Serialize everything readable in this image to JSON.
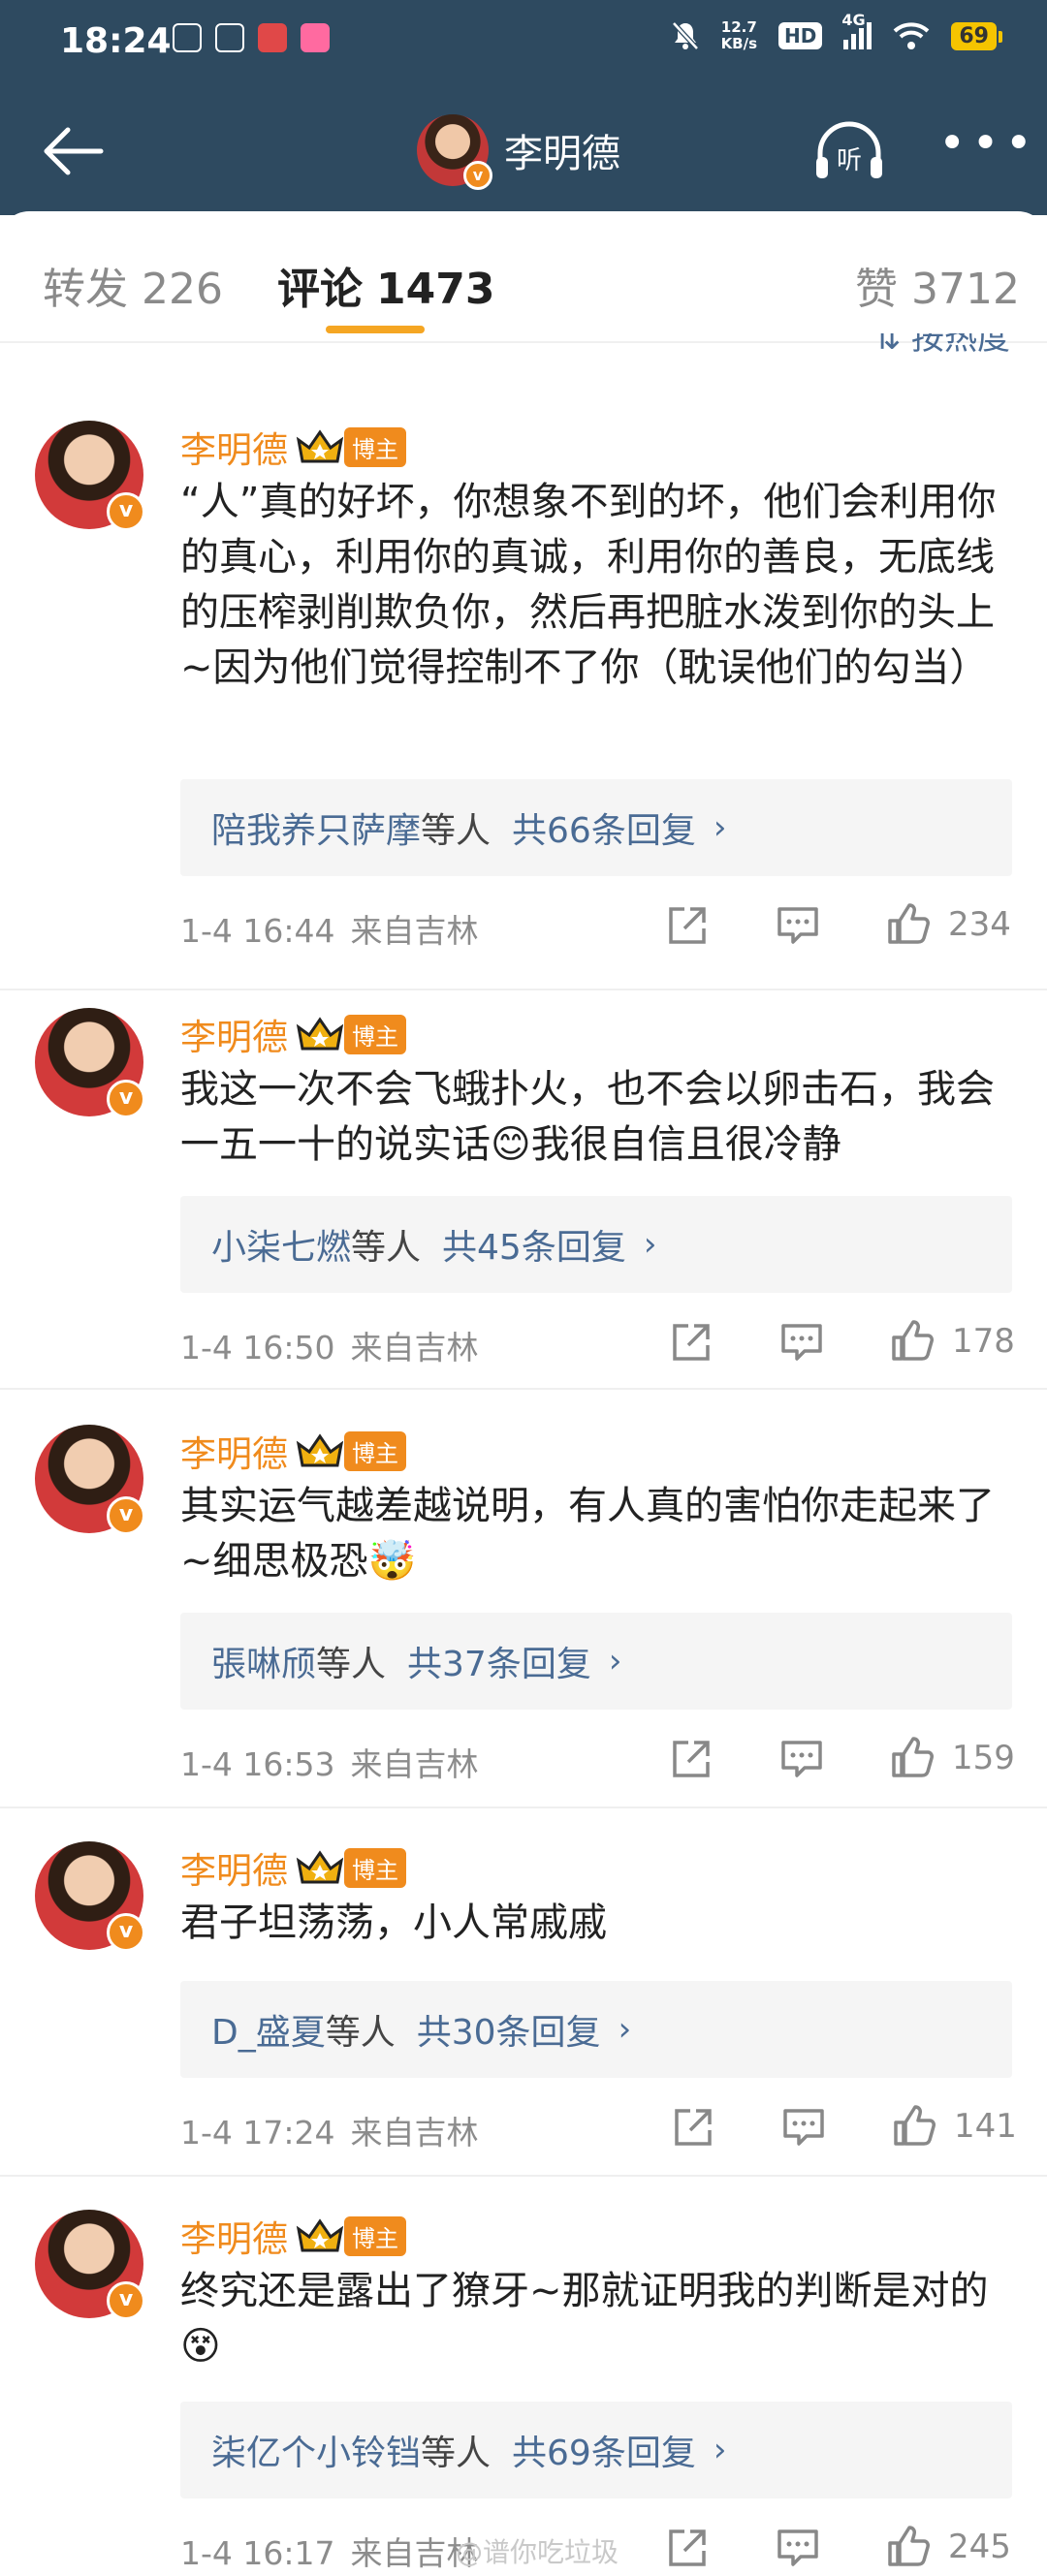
{
  "status_bar": {
    "time": "18:24",
    "net_speed_top": "12.7",
    "net_speed_bottom": "KB/s",
    "hd": "HD",
    "signal": "4G",
    "battery": "69"
  },
  "nav": {
    "title": "李明德",
    "avatar_badge": "v",
    "listen_label": "听"
  },
  "tabs": [
    {
      "label": "转发",
      "count": "226"
    },
    {
      "label": "评论",
      "count": "1473"
    },
    {
      "label": "赞",
      "count": "3712"
    }
  ],
  "sort_label": "按热度",
  "badge_label": "博主",
  "comments": [
    {
      "name": "李明德",
      "text": "“人”真的好坏，你想象不到的坏，他们会利用你的真心，利用你的真诚，利用你的善良，无底线的压榨剥削欺负你，然后再把脏水泼到你的头上~因为他们觉得控制不了你（耽误他们的勾当）",
      "reply_users": "陪我养只萨摩",
      "reply_etc": "等人",
      "reply_count": "共66条回复",
      "date": "1-4 16:44",
      "from": "来自吉林",
      "likes": "234"
    },
    {
      "name": "李明德",
      "text": "我这一次不会飞蛾扑火，也不会以卵击石，我会一五一十的说实话😊我很自信且很冷静",
      "reply_users": "小柒七燃",
      "reply_etc": "等人",
      "reply_count": "共45条回复",
      "date": "1-4 16:50",
      "from": "来自吉林",
      "likes": "178"
    },
    {
      "name": "李明德",
      "text": "其实运气越差越说明，有人真的害怕你走起来了~细思极恐🤯",
      "reply_users": "張啉颀",
      "reply_etc": "等人",
      "reply_count": "共37条回复",
      "date": "1-4 16:53",
      "from": "来自吉林",
      "likes": "159"
    },
    {
      "name": "李明德",
      "text": "君子坦荡荡，小人常戚戚",
      "reply_users": "D_盛夏",
      "reply_etc": "等人",
      "reply_count": "共30条回复",
      "date": "1-4 17:24",
      "from": "来自吉林",
      "likes": "141"
    },
    {
      "name": "李明德",
      "text": "终究还是露出了獠牙~那就证明我的判断是对的😵",
      "reply_users": "柒亿个小铃铛",
      "reply_etc": "等人",
      "reply_count": "共69条回复",
      "date": "1-4 16:17",
      "from": "来自吉林",
      "likes": "245"
    }
  ],
  "watermark": "@谱你吃垃圾"
}
